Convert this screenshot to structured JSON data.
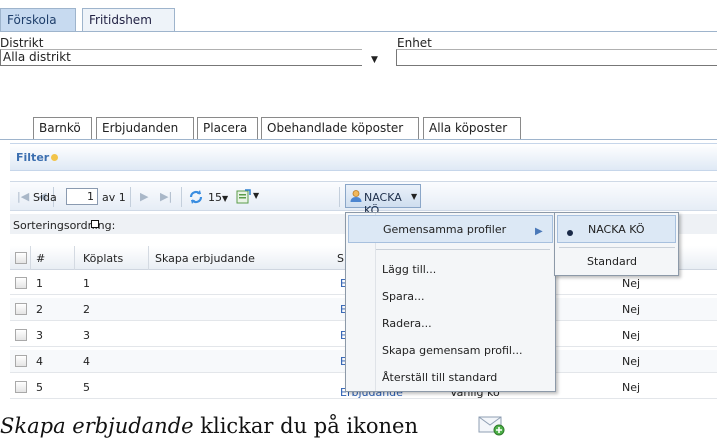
{
  "top_tabs": [
    {
      "label": "Förskola",
      "active": true
    },
    {
      "label": "Fritidshem",
      "active": false
    }
  ],
  "filters": {
    "district_label": "Distrikt",
    "district_value": "Alla distrikt",
    "unit_label": "Enhet",
    "unit_value": ""
  },
  "sub_tabs": [
    "Barnkö",
    "Erbjudanden",
    "Placera",
    "Obehandlade köposter",
    "Alla köposter"
  ],
  "filter_bar": {
    "label": "Filter"
  },
  "pager": {
    "page_label": "Sida",
    "page_value": "1",
    "of_label": "av 1",
    "page_size": "15",
    "profile_label": "NACKA KÖ"
  },
  "grid": {
    "sort_label": "Sorteringsordning:",
    "columns": [
      "#",
      "Köplats",
      "Skapa erbjudande",
      "S"
    ],
    "rows": [
      {
        "num": "1",
        "koplats": "1",
        "link": "E",
        "value": "Nej"
      },
      {
        "num": "2",
        "koplats": "2",
        "link": "E",
        "value": "Nej"
      },
      {
        "num": "3",
        "koplats": "3",
        "link": "E",
        "value": "Nej"
      },
      {
        "num": "4",
        "koplats": "4",
        "link": "E",
        "value": "Nej"
      },
      {
        "num": "5",
        "koplats": "5",
        "link": "Erbjudande",
        "mid": "Vanlig kö",
        "value": "Nej"
      }
    ]
  },
  "context_menu": {
    "items": [
      "Gemensamma profiler",
      "Lägg till...",
      "Spara...",
      "Radera...",
      "Skapa gemensam profil...",
      "Återställ till standard"
    ]
  },
  "submenu": {
    "items": [
      "NACKA KÖ",
      "Standard"
    ],
    "selected": "NACKA KÖ"
  },
  "caption": {
    "italic": "Skapa erbjudande",
    "rest": " klickar du på ikonen"
  },
  "colors": {
    "tab_active": "#c7daf0",
    "filter_text": "#3c6fb0",
    "menu_highlight": "#dce8f5",
    "link": "#2a5db0"
  }
}
